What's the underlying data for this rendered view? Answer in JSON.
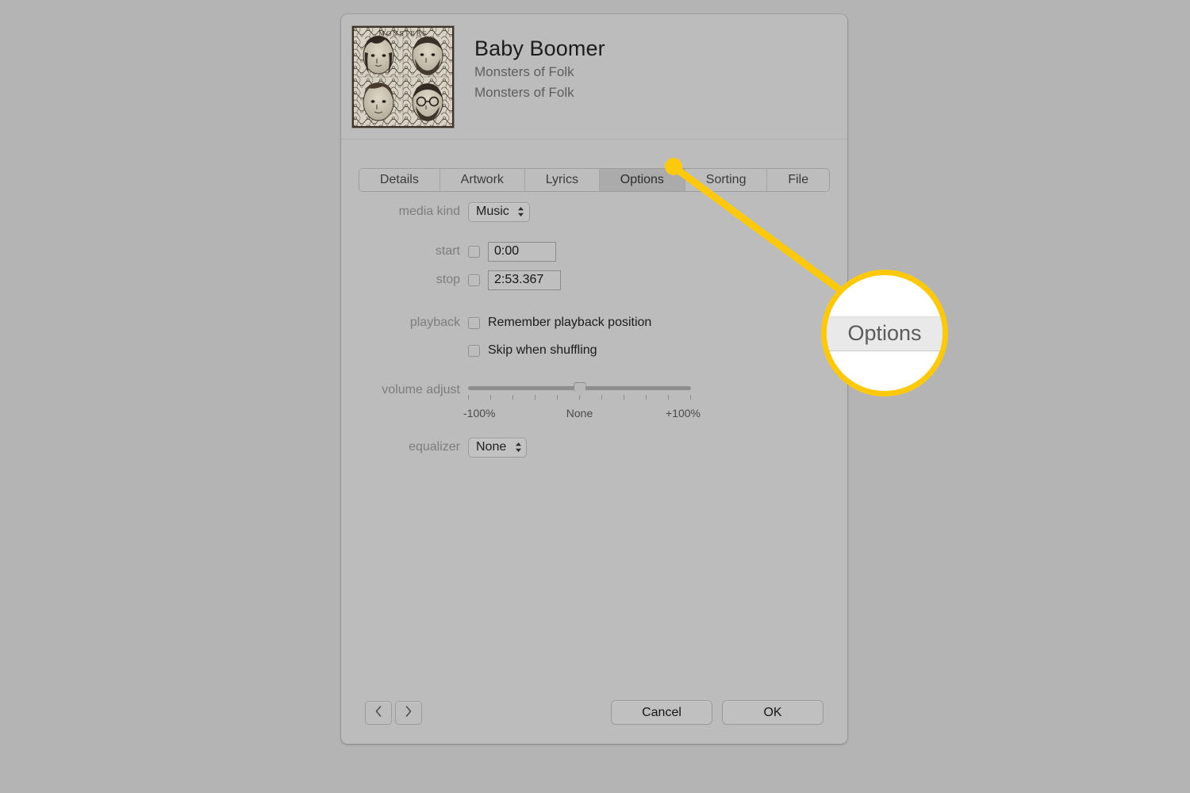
{
  "window": {
    "track_title": "Baby Boomer",
    "artist": "Monsters of Folk",
    "album": "Monsters of Folk",
    "artwork_name": "album-artwork-monsters-of-folk"
  },
  "tabs": [
    {
      "label": "Details",
      "selected": false
    },
    {
      "label": "Artwork",
      "selected": false
    },
    {
      "label": "Lyrics",
      "selected": false
    },
    {
      "label": "Options",
      "selected": true
    },
    {
      "label": "Sorting",
      "selected": false
    },
    {
      "label": "File",
      "selected": false
    }
  ],
  "options": {
    "media_kind": {
      "label": "media kind",
      "value": "Music"
    },
    "start": {
      "label": "start",
      "checked": false,
      "value": "0:00"
    },
    "stop": {
      "label": "stop",
      "checked": false,
      "value": "2:53.367"
    },
    "playback": {
      "label": "playback",
      "remember_position": {
        "label": "Remember playback position",
        "checked": false
      },
      "skip_when_shuffling": {
        "label": "Skip when shuffling",
        "checked": false
      }
    },
    "volume_adjust": {
      "label": "volume adjust",
      "min_label": "-100%",
      "mid_label": "None",
      "max_label": "+100%",
      "value": 0,
      "min": -100,
      "max": 100,
      "tick_count": 11
    },
    "equalizer": {
      "label": "equalizer",
      "value": "None"
    }
  },
  "footer": {
    "prev_label": "‹",
    "next_label": "›",
    "cancel_label": "Cancel",
    "ok_label": "OK"
  },
  "callout": {
    "magnified_label": "Options",
    "accent_color": "#fec90d"
  }
}
